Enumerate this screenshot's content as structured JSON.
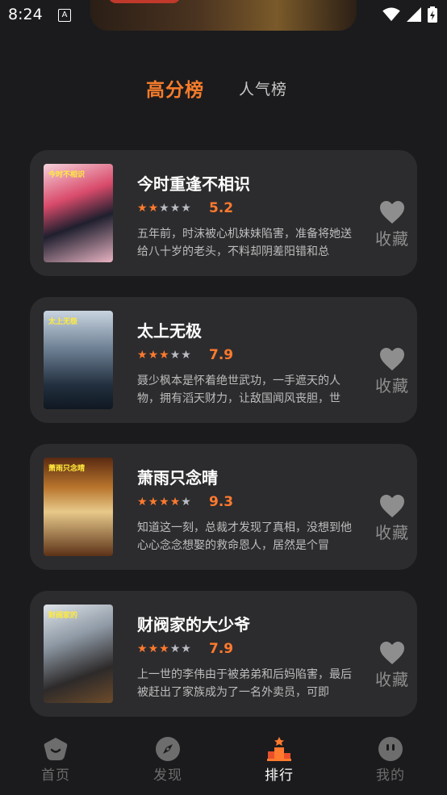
{
  "status_bar": {
    "time": "8:24",
    "notif_icon": "A",
    "icons": [
      "wifi-icon",
      "signal-icon",
      "battery-icon"
    ]
  },
  "tabs": [
    {
      "label": "高分榜",
      "active": true
    },
    {
      "label": "人气榜",
      "active": false
    }
  ],
  "colors": {
    "accent": "#ff7a2e",
    "card_bg": "#2c2c2e",
    "page_bg": "#1b1b1d"
  },
  "rankings": [
    {
      "title": "今时重逢不相识",
      "rating": 2,
      "score": "5.2",
      "description": "五年前，时沫被心机妹妹陷害，准备将她送给八十岁的老头，不料却阴差阳错和总",
      "fav_label": "收藏"
    },
    {
      "title": "太上无极",
      "rating": 3,
      "score": "7.9",
      "description": "聂少枫本是怀着绝世武功，一手遮天的人物，拥有滔天财力，让敌国闻风丧胆，世",
      "fav_label": "收藏"
    },
    {
      "title": "萧雨只念晴",
      "rating": 4,
      "score": "9.3",
      "description": "知道这一刻，总裁才发现了真相，没想到他心心念念想娶的救命恩人，居然是个冒",
      "fav_label": "收藏"
    },
    {
      "title": "财阀家的大少爷",
      "rating": 3,
      "score": "7.9",
      "description": "上一世的李伟由于被弟弟和后妈陷害，最后被赶出了家族成为了一名外卖员，可即",
      "fav_label": "收藏"
    }
  ],
  "posters": [
    {
      "text": "今时不相识"
    },
    {
      "text": "太上无极"
    },
    {
      "text": "萧雨只念晴"
    },
    {
      "text": "财阀家的"
    }
  ],
  "nav": [
    {
      "label": "首页",
      "icon": "home-icon",
      "active": false
    },
    {
      "label": "发现",
      "icon": "compass-icon",
      "active": false
    },
    {
      "label": "排行",
      "icon": "rank-icon",
      "active": true
    },
    {
      "label": "我的",
      "icon": "profile-icon",
      "active": false
    }
  ]
}
